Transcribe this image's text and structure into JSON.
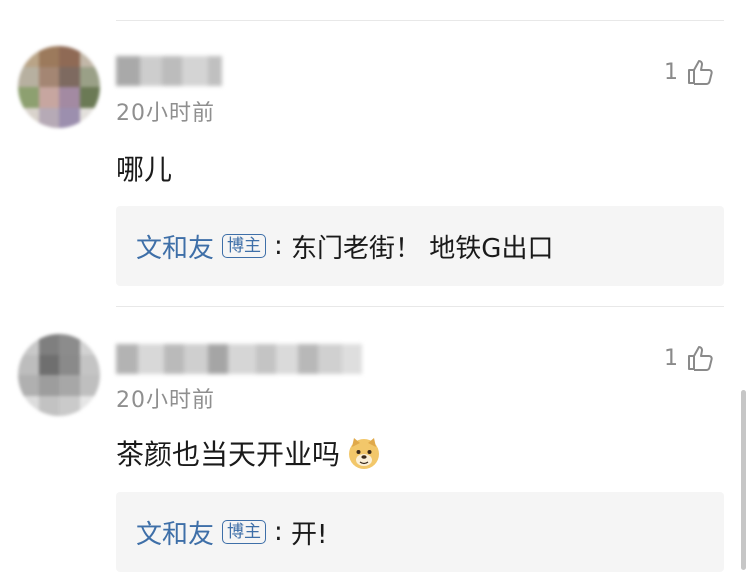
{
  "comments": [
    {
      "time": "20小时前",
      "like_count": "1",
      "text": "哪儿",
      "reply": {
        "author": "文和友",
        "badge": "博主",
        "text": "东门老街！ 地铁G出口"
      }
    },
    {
      "time": "20小时前",
      "like_count": "1",
      "text": "茶颜也当天开业吗",
      "emoji": "doge-emoji",
      "reply": {
        "author": "文和友",
        "badge": "博主",
        "text": "开!"
      }
    }
  ],
  "colors": {
    "link_blue": "#3e6fa8",
    "meta_gray": "#8f8f8f",
    "reply_bg": "#f5f5f5"
  },
  "icons": [
    "thumbs-up-icon",
    "doge-emoji"
  ]
}
